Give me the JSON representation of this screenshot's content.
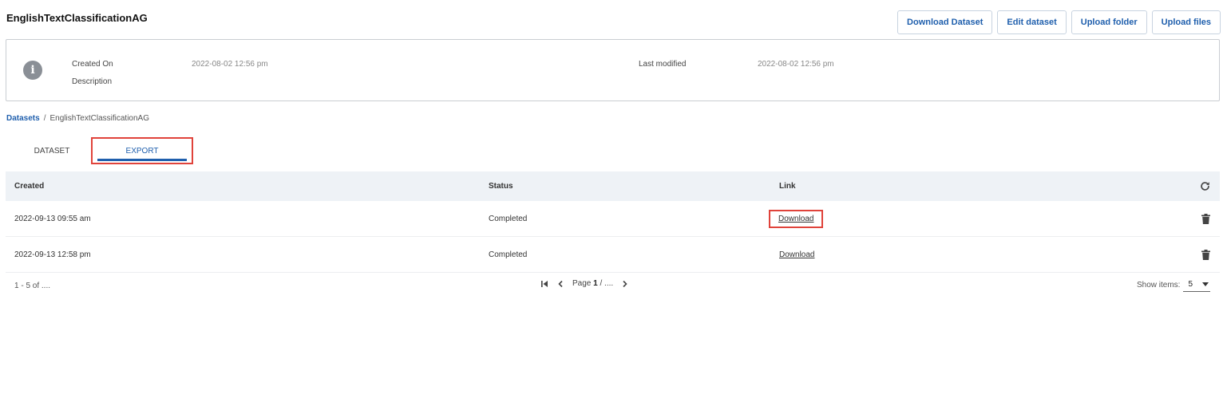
{
  "header": {
    "title": "EnglishTextClassificationAG",
    "actions": {
      "download_dataset": "Download Dataset",
      "edit_dataset": "Edit dataset",
      "upload_folder": "Upload folder",
      "upload_files": "Upload files"
    }
  },
  "info": {
    "icon": "info-icon",
    "created_on_label": "Created On",
    "created_on_value": "2022-08-02 12:56 pm",
    "description_label": "Description",
    "last_modified_label": "Last modified",
    "last_modified_value": "2022-08-02 12:56 pm"
  },
  "breadcrumb": {
    "root": "Datasets",
    "separator": "/",
    "current": "EnglishTextClassificationAG"
  },
  "tabs": {
    "dataset": "DATASET",
    "export": "EXPORT",
    "active": "EXPORT"
  },
  "table": {
    "headers": {
      "created": "Created",
      "status": "Status",
      "link": "Link"
    },
    "rows": [
      {
        "created": "2022-09-13 09:55 am",
        "status": "Completed",
        "link": "Download"
      },
      {
        "created": "2022-09-13 12:58 pm",
        "status": "Completed",
        "link": "Download"
      }
    ]
  },
  "pagination": {
    "range": "1 - 5 of ....",
    "page_label": "Page",
    "page_current": "1",
    "page_sep": "/",
    "page_total": "....",
    "show_items_label": "Show items:",
    "show_items_value": "5"
  },
  "colors": {
    "accent": "#1f5fad",
    "highlight": "#e0433b",
    "header_bg": "#eef2f6"
  }
}
